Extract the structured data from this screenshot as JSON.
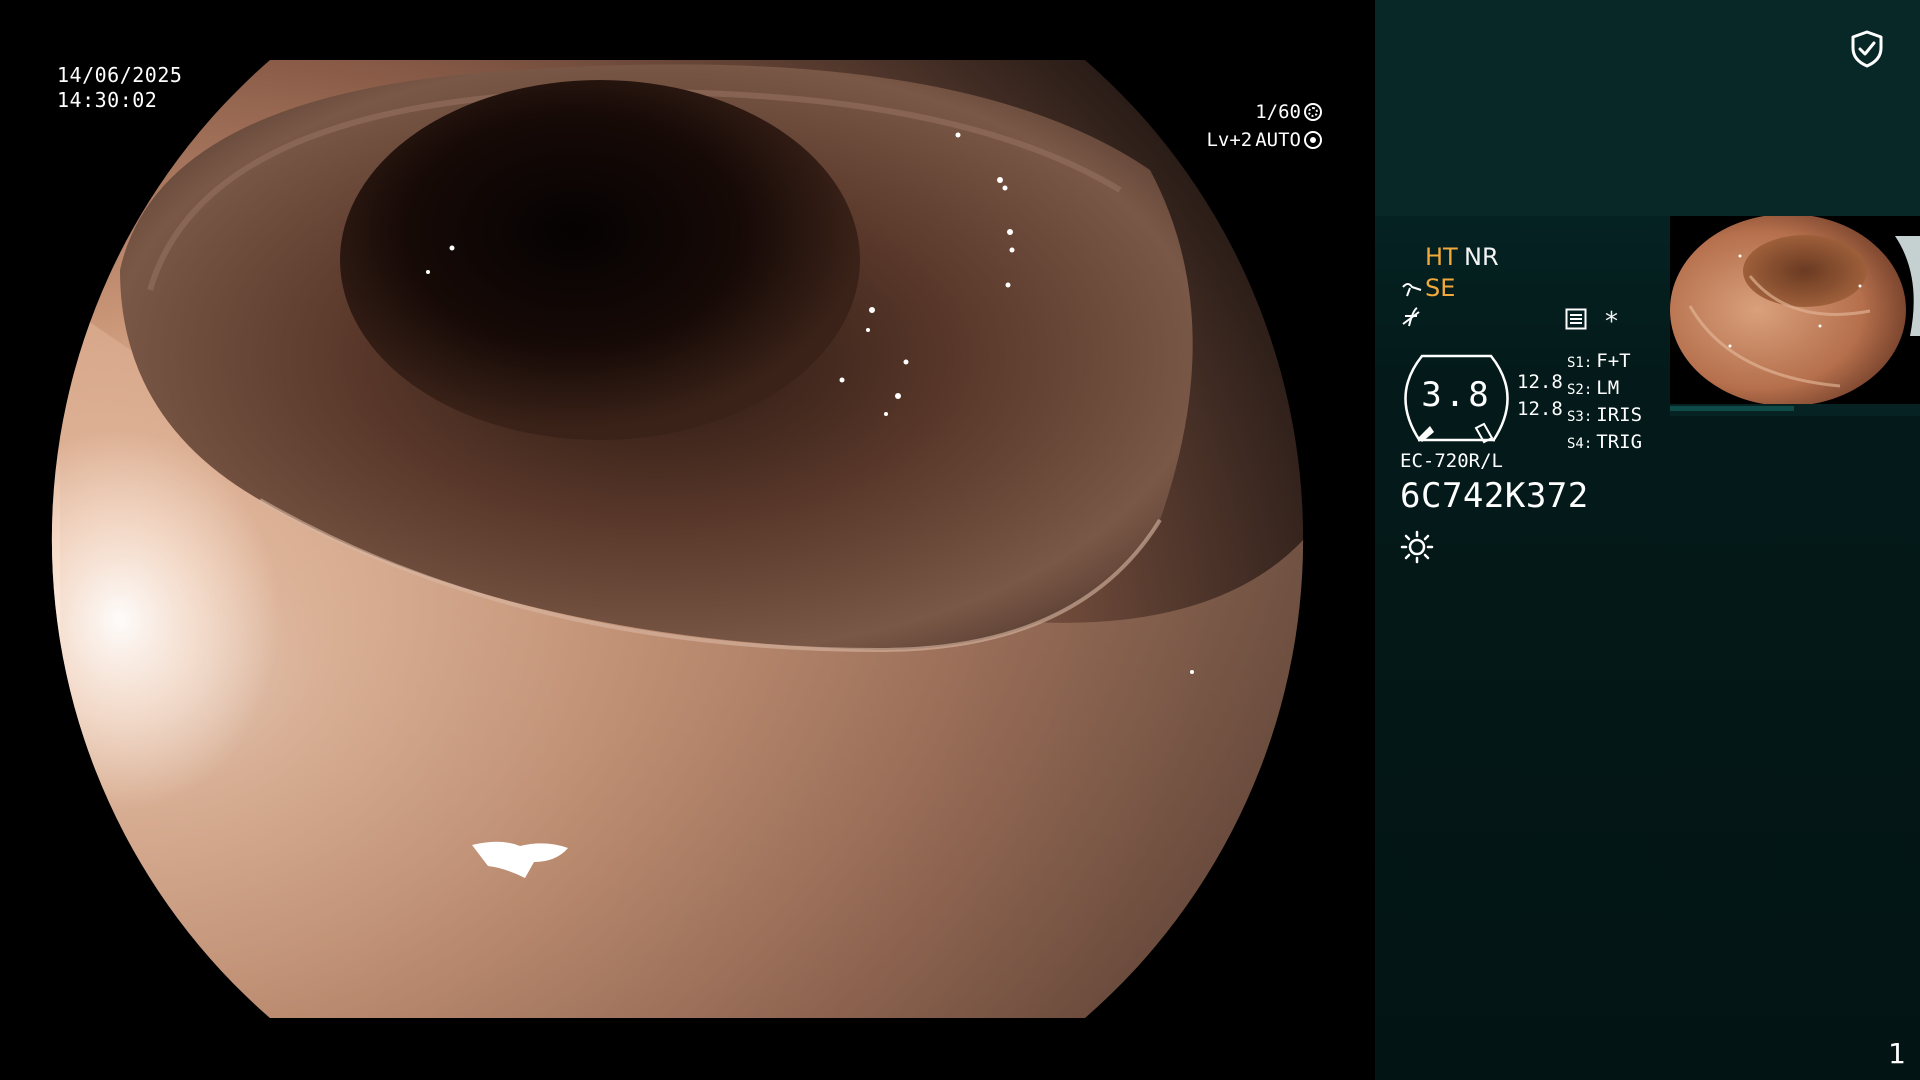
{
  "overlay": {
    "date": "14/06/2025",
    "time": "14:30:02",
    "shutter": "1/60",
    "level": "Lv+2",
    "iris_mode": "AUTO"
  },
  "panel": {
    "ht": "HT",
    "nr": "NR",
    "se": "SE",
    "asterisk": "*",
    "gauge_value": "3.8",
    "gauge_sub_1": "12.8",
    "gauge_sub_2": "12.8",
    "switches": [
      {
        "key": "S1:",
        "value": "F+T"
      },
      {
        "key": "S2:",
        "value": "LM"
      },
      {
        "key": "S3:",
        "value": "IRIS"
      },
      {
        "key": "S4:",
        "value": "TRIG"
      }
    ],
    "scope_model": "EC-720R/L",
    "scope_serial": "6C742K372",
    "page_number": "1"
  },
  "icons": {
    "status": "shield-check-icon",
    "shutter": "shutter-icon",
    "iris": "iris-icon",
    "enhance": "enhance-curve-icon",
    "contrast": "contrast-icon",
    "menu": "menu-list-icon",
    "light": "light-sun-icon"
  },
  "colors": {
    "indicator_orange": "#f2a93b",
    "panel_bg": "#041a1a",
    "panel_top": "#072827"
  }
}
